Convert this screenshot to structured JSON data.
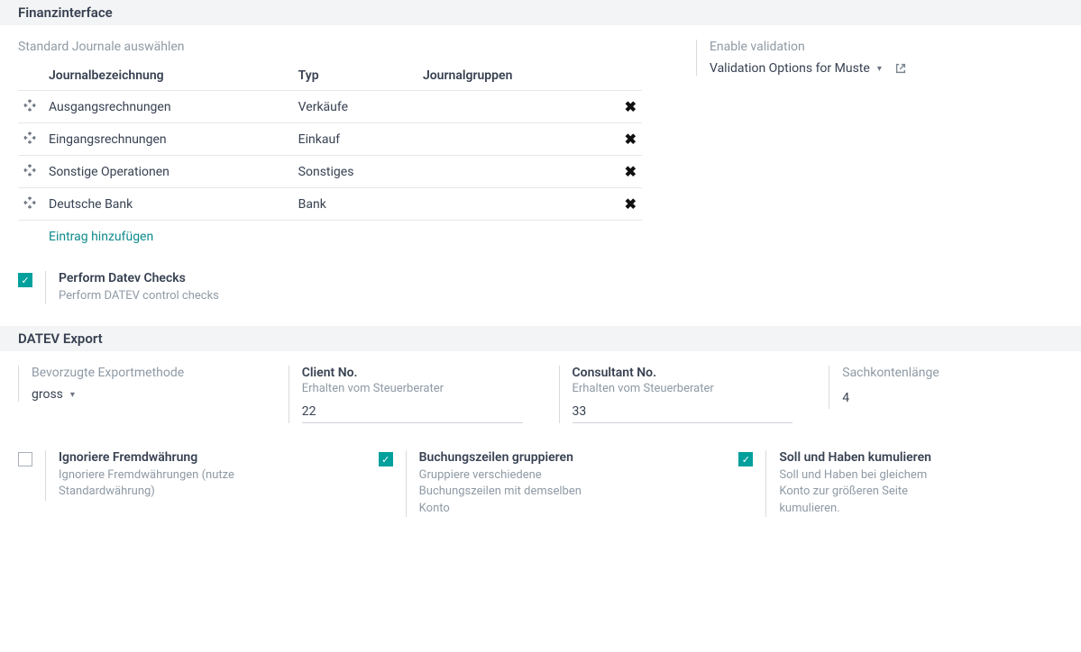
{
  "section1": {
    "title": "Finanzinterface",
    "journals_label": "Standard Journale auswählen",
    "headers": {
      "name": "Journalbezeichnung",
      "type": "Typ",
      "groups": "Journalgruppen"
    },
    "rows": [
      {
        "name": "Ausgangsrechnungen",
        "type": "Verkäufe",
        "groups": ""
      },
      {
        "name": "Eingangsrechnungen",
        "type": "Einkauf",
        "groups": ""
      },
      {
        "name": "Sonstige Operationen",
        "type": "Sonstiges",
        "groups": ""
      },
      {
        "name": "Deutsche Bank",
        "type": "Bank",
        "groups": ""
      }
    ],
    "add_link": "Eintrag hinzufügen",
    "datev_check": {
      "title": "Perform Datev Checks",
      "desc": "Perform DATEV control checks",
      "checked": true
    },
    "validation": {
      "label": "Enable validation",
      "value": "Validation Options for Muste"
    }
  },
  "section2": {
    "title": "DATEV Export",
    "export_method": {
      "label": "Bevorzugte Exportmethode",
      "value": "gross"
    },
    "client_no": {
      "label": "Client No.",
      "sub": "Erhalten vom Steuerberater",
      "value": "22"
    },
    "consultant_no": {
      "label": "Consultant No.",
      "sub": "Erhalten vom Steuerberater",
      "value": "33"
    },
    "sachkonten": {
      "label": "Sachkontenlänge",
      "value": "4"
    },
    "ignore_fx": {
      "title": "Ignoriere Fremdwährung",
      "desc": "Ignoriere Fremdwährungen (nutze Standardwährung)",
      "checked": false
    },
    "group_lines": {
      "title": "Buchungszeilen gruppieren",
      "desc": "Gruppiere verschiedene Buchungszeilen mit demselben Konto",
      "checked": true
    },
    "cumulate": {
      "title": "Soll und Haben kumulieren",
      "desc": "Soll und Haben bei gleichem Konto zur größeren Seite kumulieren.",
      "checked": true
    }
  }
}
